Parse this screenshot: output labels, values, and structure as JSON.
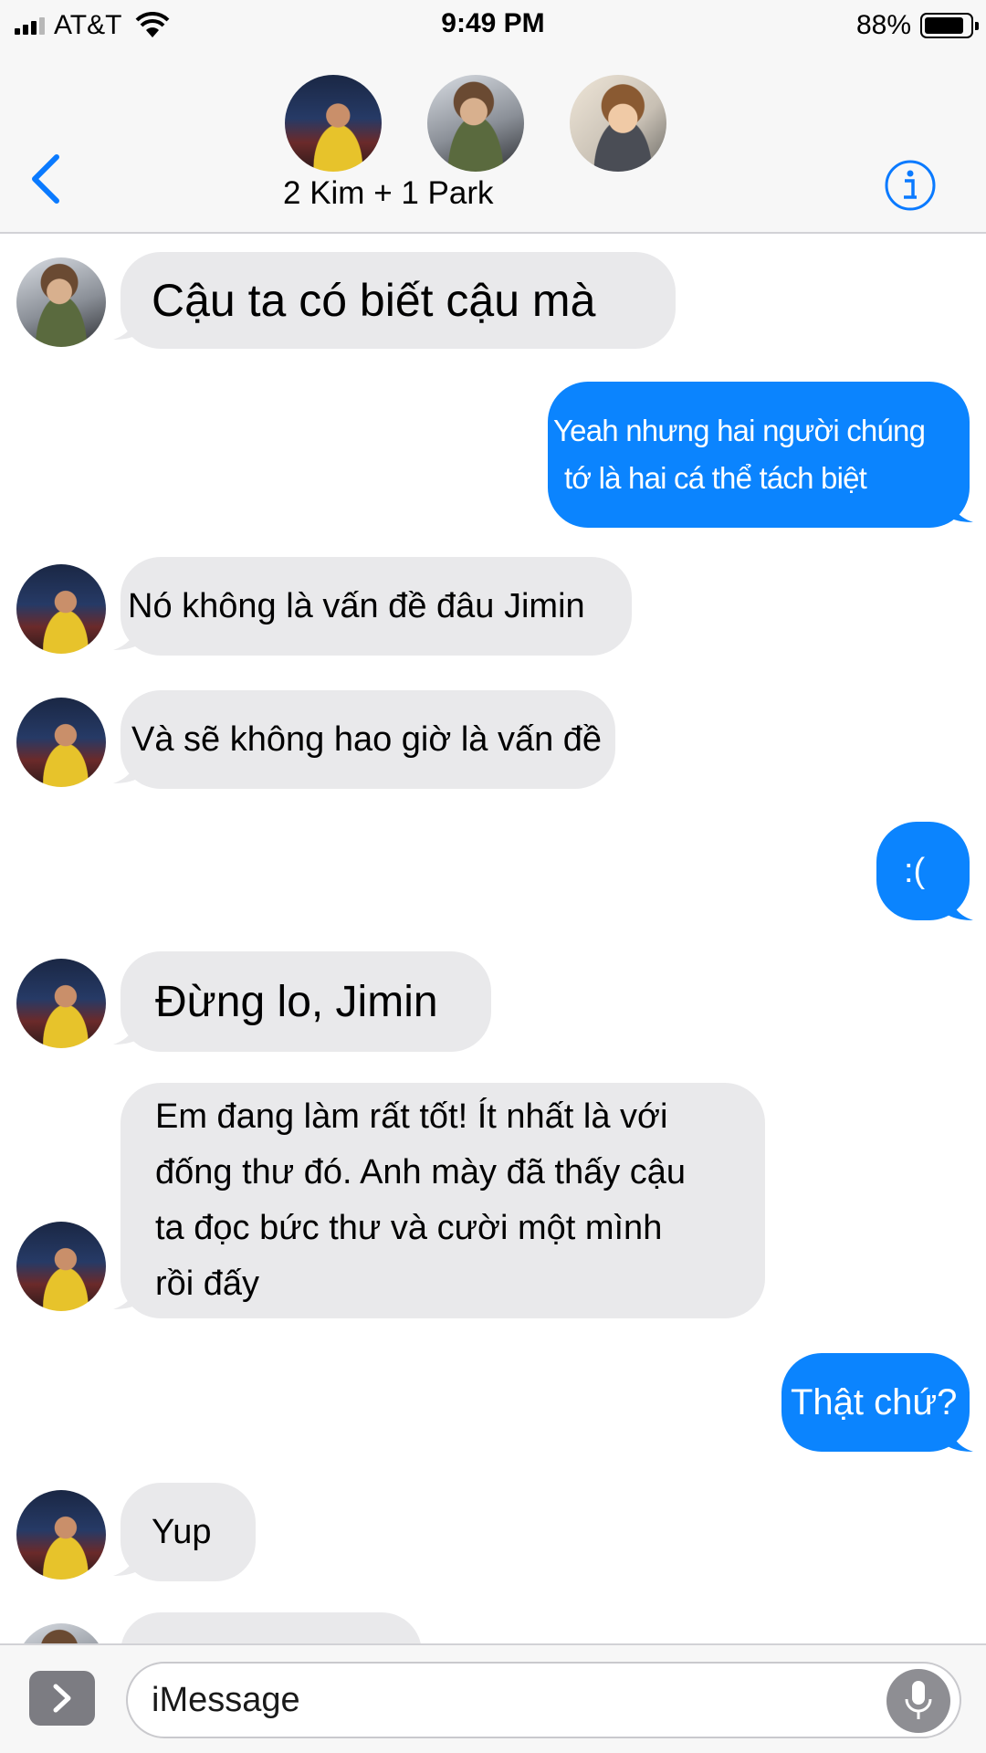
{
  "status_bar": {
    "carrier": "AT&T",
    "time": "9:49 PM",
    "battery_percent": "88%",
    "battery_level": 0.88
  },
  "header": {
    "group_name": "2 Kim + 1 Park",
    "participants": [
      "Kim (yellow shirt)",
      "Kim (floral shirt)",
      "Park (glasses)"
    ],
    "back_icon": "chevron-left-icon",
    "info_icon": "info-icon"
  },
  "messages": [
    {
      "direction": "incoming",
      "sender_avatar": "floral-shirt",
      "text": "Cậu ta có biết cậu mà"
    },
    {
      "direction": "outgoing",
      "lines": [
        "Yeah nhưng hai người chúng",
        "tớ là hai cá thể tách biệt"
      ]
    },
    {
      "direction": "incoming",
      "sender_avatar": "yellow-shirt",
      "text": "Nó không là vấn đề đâu Jimin"
    },
    {
      "direction": "incoming",
      "sender_avatar": "yellow-shirt",
      "text": "Và sẽ không hao giờ là vấn đề"
    },
    {
      "direction": "outgoing",
      "text": ":("
    },
    {
      "direction": "incoming",
      "sender_avatar": "yellow-shirt",
      "text": "Đừng lo, Jimin"
    },
    {
      "direction": "incoming",
      "sender_avatar": "yellow-shirt",
      "lines": [
        "Em đang làm rất tốt! Ít nhất là với",
        "đống thư đó. Anh mày đã thấy cậu",
        "ta đọc bức thư và cười một mình",
        "rồi đấy"
      ]
    },
    {
      "direction": "outgoing",
      "text": "Thật chứ?"
    },
    {
      "direction": "incoming",
      "sender_avatar": "yellow-shirt",
      "text": "Yup"
    }
  ],
  "input_bar": {
    "placeholder": "iMessage",
    "apps_icon": "chevron-right-icon",
    "mic_icon": "microphone-icon"
  },
  "colors": {
    "bubble_outgoing": "#0b84fe",
    "bubble_incoming": "#e9e9eb",
    "accent": "#0a7aff",
    "bar_background": "#f7f7f7"
  }
}
